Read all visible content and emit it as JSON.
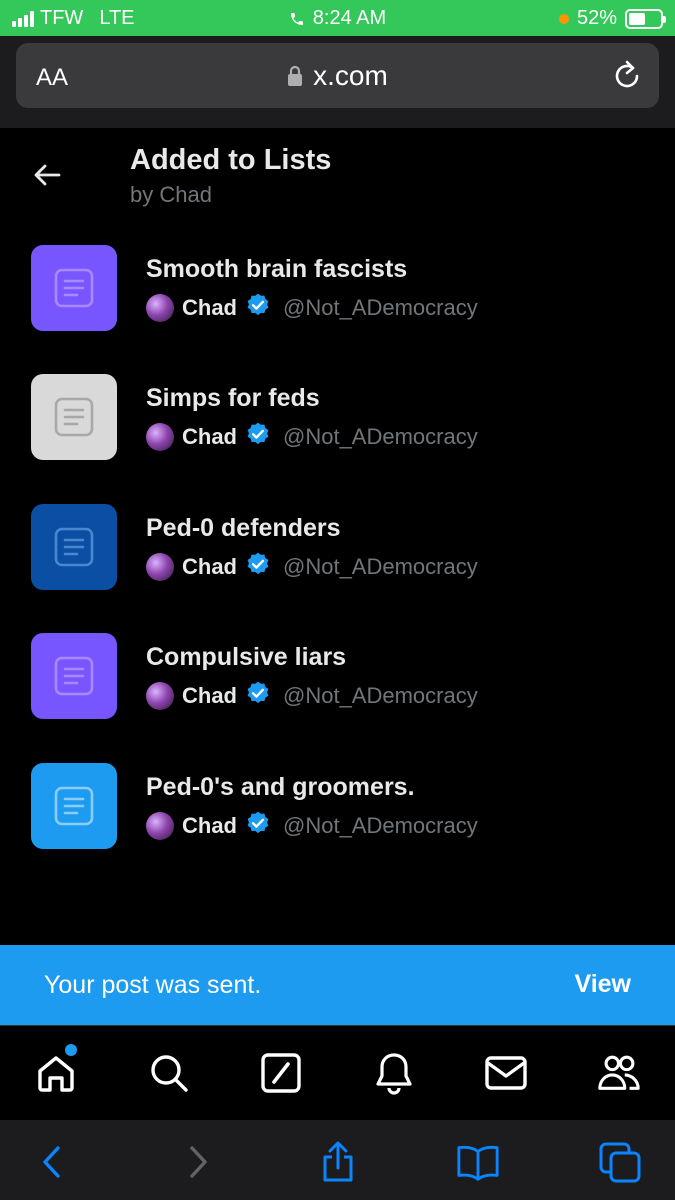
{
  "status_bar": {
    "carrier": "TFW",
    "network": "LTE",
    "time": "8:24 AM",
    "battery_percent": "52%",
    "battery_level": 0.52
  },
  "browser": {
    "text_size_button": "AA",
    "url": "x.com"
  },
  "header": {
    "title": "Added to Lists",
    "subtitle": "by Chad"
  },
  "lists": [
    {
      "name": "Smooth brain fascists",
      "owner": "Chad",
      "handle": "@Not_ADemocracy",
      "color": "#7856ff",
      "icon_color": "#a58bff"
    },
    {
      "name": "Simps for feds",
      "owner": "Chad",
      "handle": "@Not_ADemocracy",
      "color": "#d9d9d9",
      "icon_color": "#a8a8a8"
    },
    {
      "name": "Ped-0 defenders",
      "owner": "Chad",
      "handle": "@Not_ADemocracy",
      "color": "#0a4fa3",
      "icon_color": "#4b86d1"
    },
    {
      "name": "Compulsive liars",
      "owner": "Chad",
      "handle": "@Not_ADemocracy",
      "color": "#7856ff",
      "icon_color": "#a58bff"
    },
    {
      "name": "Ped-0's and groomers.",
      "owner": "Chad",
      "handle": "@Not_ADemocracy",
      "color": "#1d9bf0",
      "icon_color": "#8dccf7"
    }
  ],
  "toast": {
    "message": "Your post was sent.",
    "action": "View"
  },
  "colors": {
    "accent": "#1d9bf0",
    "status_green": "#34c759",
    "verified": "#1d9bf0"
  },
  "nav_icons": [
    "home-icon",
    "search-icon",
    "compose-icon",
    "notifications-icon",
    "messages-icon",
    "communities-icon"
  ],
  "safari_icons": [
    "back-icon",
    "forward-icon",
    "share-icon",
    "bookmarks-icon",
    "tabs-icon"
  ]
}
